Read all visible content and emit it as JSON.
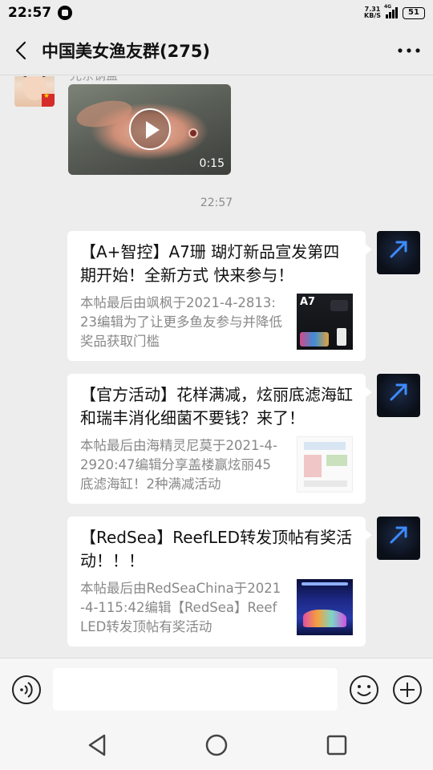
{
  "status_bar": {
    "time": "22:57",
    "net_speed_value": "7.31",
    "net_speed_unit": "KB/S",
    "signal_type": "4G",
    "battery": "51"
  },
  "header": {
    "title": "中国美女渔友群(275)",
    "back_icon": "chevron-left-icon",
    "more_icon": "more-dots-icon"
  },
  "messages": {
    "video_message": {
      "sender_name": "光东钢盖",
      "duration": "0:15"
    },
    "timestamp": "22:57",
    "cards": [
      {
        "title": "【A+智控】A7珊 瑚灯新品宣发第四期开始！全新方式 快来参与！",
        "description": "本帖最后由飒枫于2021-4-2813:23编辑为了让更多鱼友参与并降低奖品获取门槛",
        "thumb_label": "A7"
      },
      {
        "title": "【官方活动】花样满减，炫丽底滤海缸和瑞丰消化细菌不要钱？来了！",
        "description": "本帖最后由海精灵尼莫于2021-4-2920:47编辑分享盖楼赢炫丽45底滤海缸！2种满减活动",
        "thumb_label": ""
      },
      {
        "title": "【RedSea】ReefLED转发顶帖有奖活动！！！",
        "description": "本帖最后由RedSeaChina于2021-4-115:42编辑【RedSea】ReefLED转发顶帖有奖活动",
        "thumb_label": ""
      }
    ]
  },
  "input_bar": {
    "input_value": "",
    "voice_icon": "voice-input-icon",
    "emoji_icon": "emoji-icon",
    "plus_icon": "plus-circle-icon"
  },
  "nav_bar": {
    "back_icon": "nav-back-triangle-icon",
    "home_icon": "nav-home-circle-icon",
    "recent_icon": "nav-recent-square-icon"
  },
  "colors": {
    "background": "#ededed",
    "card": "#ffffff",
    "secondary_text": "#888888",
    "timestamp_text": "#8c8c8c"
  }
}
